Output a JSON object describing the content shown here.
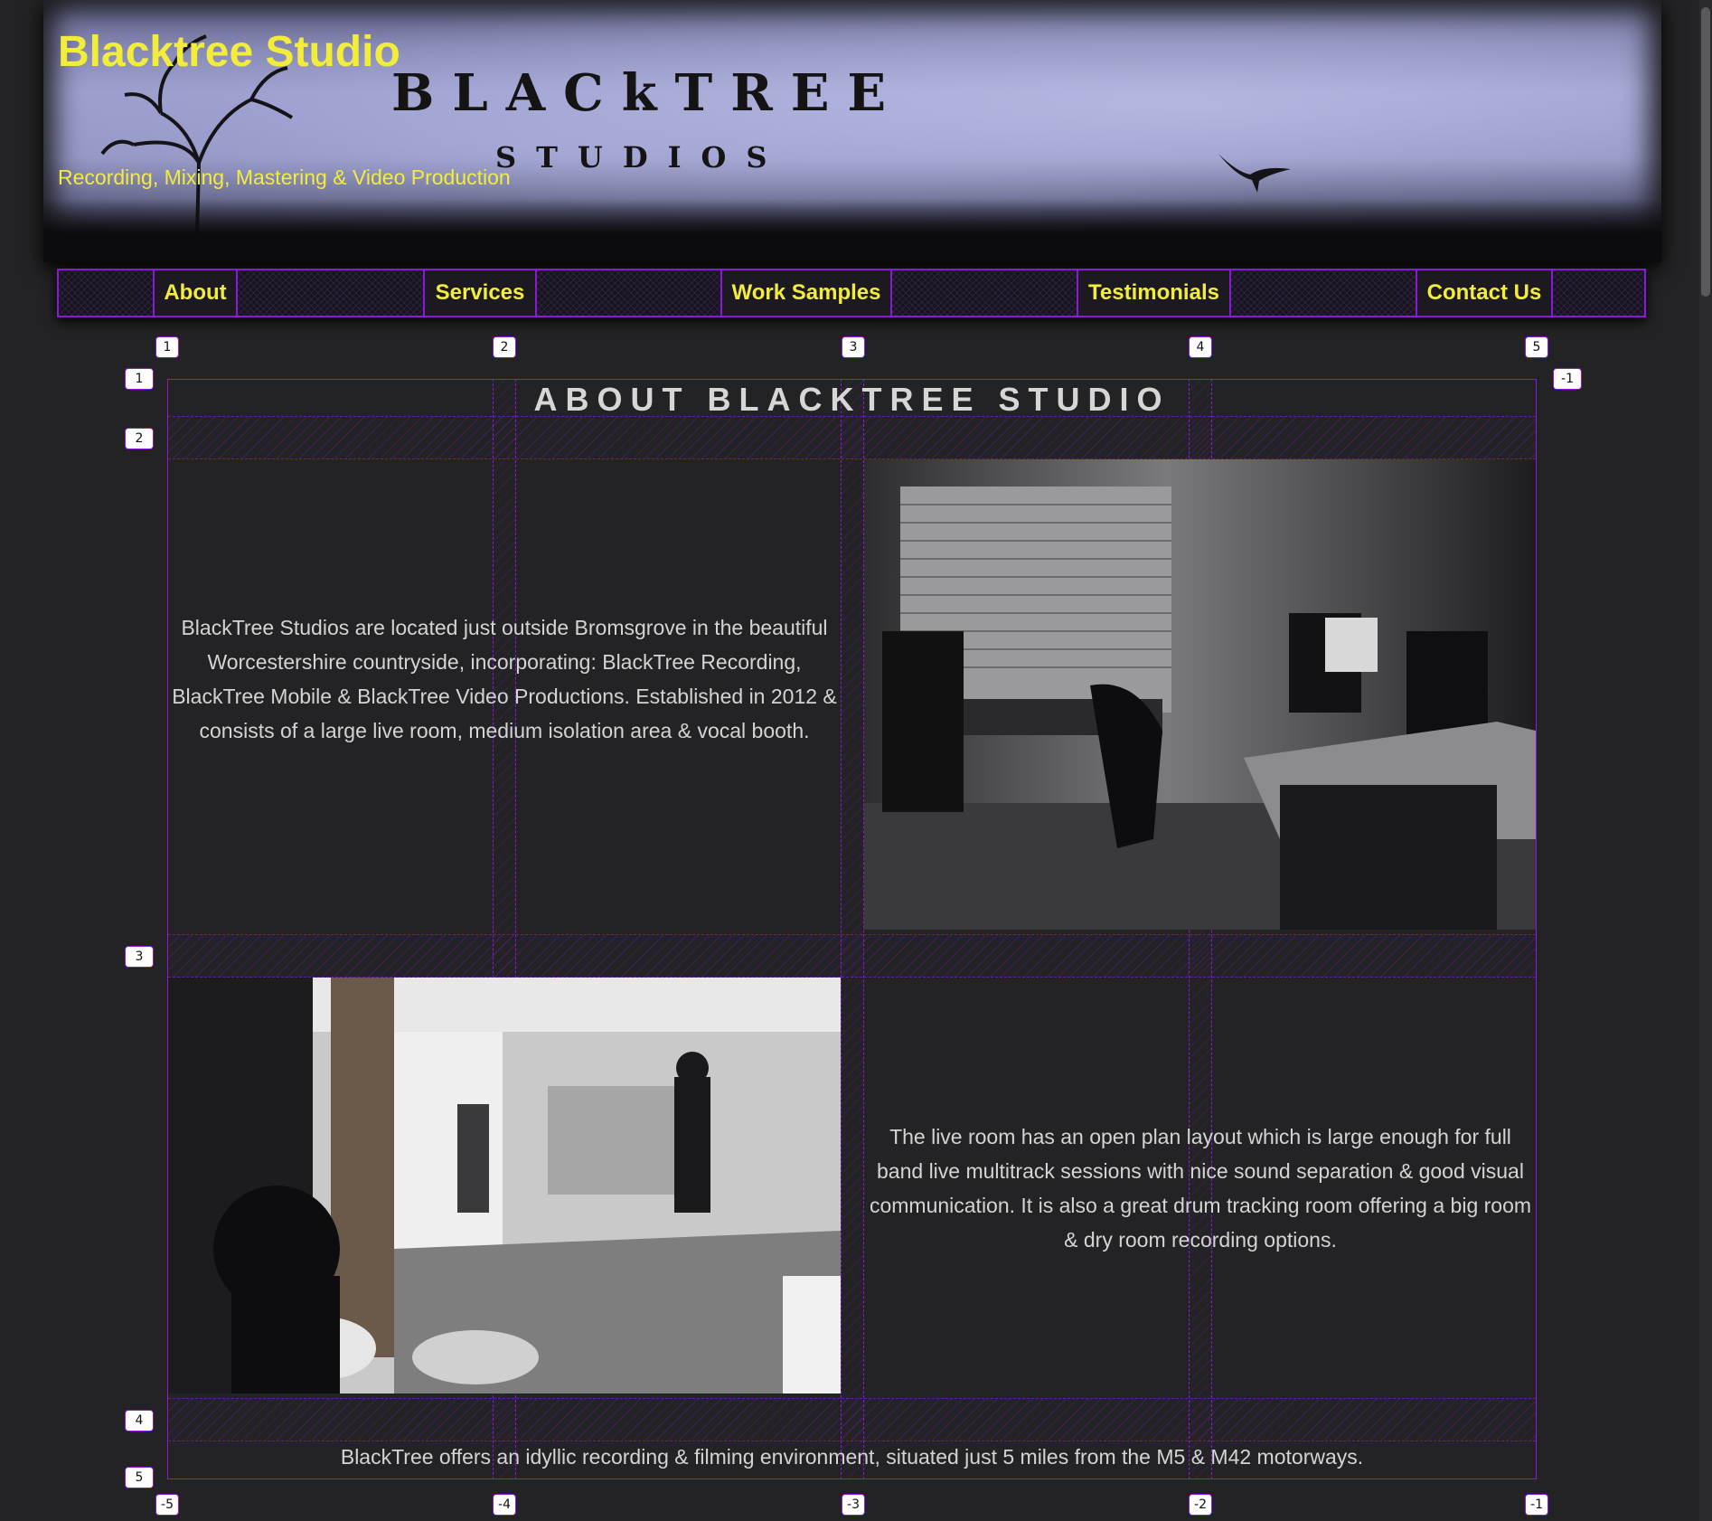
{
  "site": {
    "title": "Blacktree Studio",
    "tagline": "Recording, Mixing, Mastering & Video Production",
    "logo_main": "BLACkTREE",
    "logo_sub": "STUDIOS"
  },
  "nav": {
    "items": [
      {
        "label": "About"
      },
      {
        "label": "Services"
      },
      {
        "label": "Work Samples"
      },
      {
        "label": "Testimonials"
      },
      {
        "label": "Contact Us"
      }
    ]
  },
  "about": {
    "heading": "ABOUT BLACKTREE STUDIO",
    "para1": "BlackTree Studios are located just outside Bromsgrove in the beautiful Worcestershire countryside, incorporating: BlackTree Recording, BlackTree Mobile & BlackTree Video Productions. Established in 2012 & consists of a large live room, medium isolation area & vocal booth.",
    "para2": "The live room has an open plan layout which is large enough for full band live multitrack sessions with nice sound separation & good visual communication. It is also a great drum tracking room offering a big room & dry room recording options.",
    "footer_line": "BlackTree offers an idyllic recording & filming environment, situated just 5 miles from the M5 & M42 motorways."
  },
  "grid_overlay": {
    "column_labels_top": [
      "1",
      "2",
      "3",
      "4",
      "5"
    ],
    "column_labels_bottom": [
      "-5",
      "-4",
      "-3",
      "-2",
      "-1"
    ],
    "row_labels_left": [
      "1",
      "2",
      "3",
      "4",
      "5"
    ],
    "row_label_right": "-1"
  },
  "colors": {
    "accent": "#8a19d8",
    "title_yellow": "#f2ec3a",
    "background": "#232224"
  }
}
